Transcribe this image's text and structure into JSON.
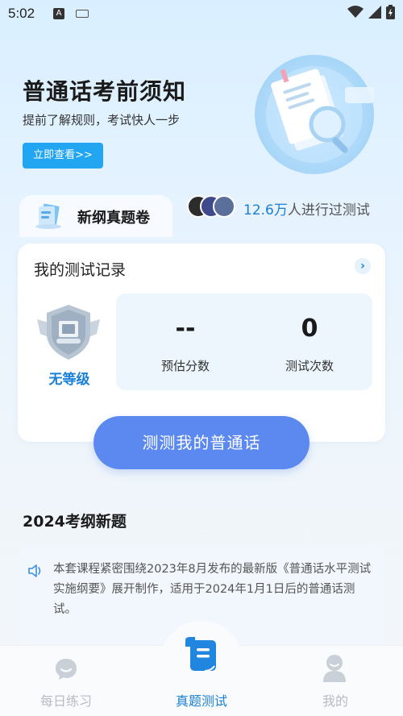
{
  "status_bar": {
    "time": "5:02",
    "a_icon": "A"
  },
  "hero": {
    "title": "普通话考前须知",
    "subtitle": "提前了解规则，考试快人一步",
    "button_label": "立即查看>>"
  },
  "exam_tab": {
    "title": "新纲真题卷",
    "participants_count": "12.6万",
    "participants_text": "人进行过测试"
  },
  "record": {
    "title": "我的测试记录",
    "level": "无等级",
    "stats": [
      {
        "value": "--",
        "label": "预估分数"
      },
      {
        "value": "0",
        "label": "测试次数"
      }
    ],
    "test_button": "测测我的普通话"
  },
  "new_section": {
    "title": "2024考纲新题",
    "description": "本套课程紧密围绕2023年8月发布的最新版《普通话水平测试实施纲要》展开制作，适用于2024年1月1日后的普通话测试。"
  },
  "bottom_nav": [
    {
      "label": "每日练习",
      "icon": "chat-bubble-icon",
      "active": false
    },
    {
      "label": "真题测试",
      "icon": "scroll-icon",
      "active": true
    },
    {
      "label": "我的",
      "icon": "user-icon",
      "active": false
    }
  ],
  "colors": {
    "accent": "#1a7fd6",
    "button": "#5c89f0",
    "hero_button": "#23a6f2"
  }
}
